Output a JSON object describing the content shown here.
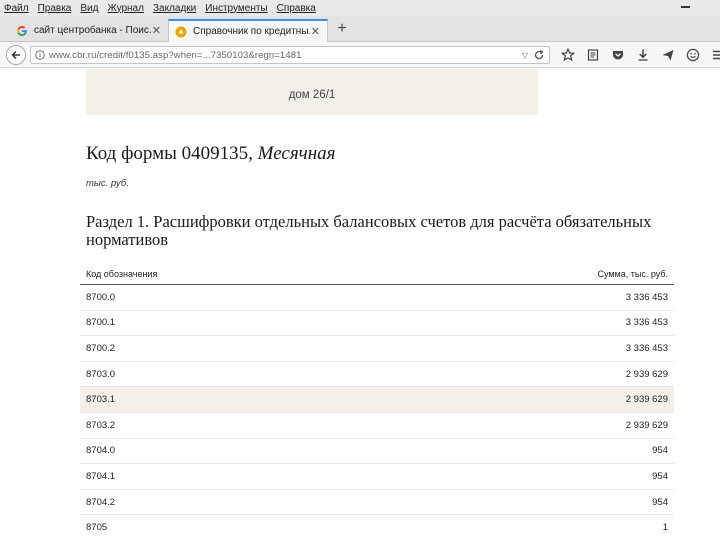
{
  "browser": {
    "menu": [
      "Файл",
      "Правка",
      "Вид",
      "Журнал",
      "Закладки",
      "Инструменты",
      "Справка"
    ],
    "tabs": [
      {
        "title": "сайт центробанка - Поис...",
        "active": false
      },
      {
        "title": "Справочник по кредитны...",
        "active": true
      }
    ],
    "new_tab_label": "+",
    "url": "www.cbr.ru/credit/f0135.asp?when=...7350103&regn=1481",
    "tab_close_glyph": "✕",
    "dropdown_glyph": "▽"
  },
  "page": {
    "address": "дом 26/1",
    "form_title_prefix": "Код формы 0409135, ",
    "form_title_type": "Месячная",
    "units": "тыс. руб.",
    "section_title": "Раздел 1. Расшифровки отдельных балансовых счетов для расчёта обязательных нормативов",
    "table": {
      "columns": [
        "Код обозначения",
        "Сумма, тыс. руб."
      ],
      "rows": [
        {
          "code": "8700.0",
          "amount": "3 336 453"
        },
        {
          "code": "8700.1",
          "amount": "3 336 453"
        },
        {
          "code": "8700.2",
          "amount": "3 336 453"
        },
        {
          "code": "8703.0",
          "amount": "2 939 629"
        },
        {
          "code": "8703.1",
          "amount": "2 939 629",
          "highlight": true
        },
        {
          "code": "8703.2",
          "amount": "2 939 629"
        },
        {
          "code": "8704.0",
          "amount": "954"
        },
        {
          "code": "8704.1",
          "amount": "954"
        },
        {
          "code": "8704.2",
          "amount": "954"
        },
        {
          "code": "8705",
          "amount": "1"
        }
      ]
    }
  },
  "colors": {
    "accent_tab": "#3b8eea",
    "address_bg": "#f4f0e9",
    "highlight_row": "#f4f0e9"
  },
  "icons": {
    "menu_minimize": "minimize-icon",
    "tab1_favicon": "google-icon",
    "tab2_favicon": "page-favicon-icon",
    "toolbar": [
      "star-icon",
      "reading-list-icon",
      "pocket-icon",
      "download-icon",
      "send-icon",
      "smiley-icon",
      "hamburger-menu-icon"
    ]
  }
}
